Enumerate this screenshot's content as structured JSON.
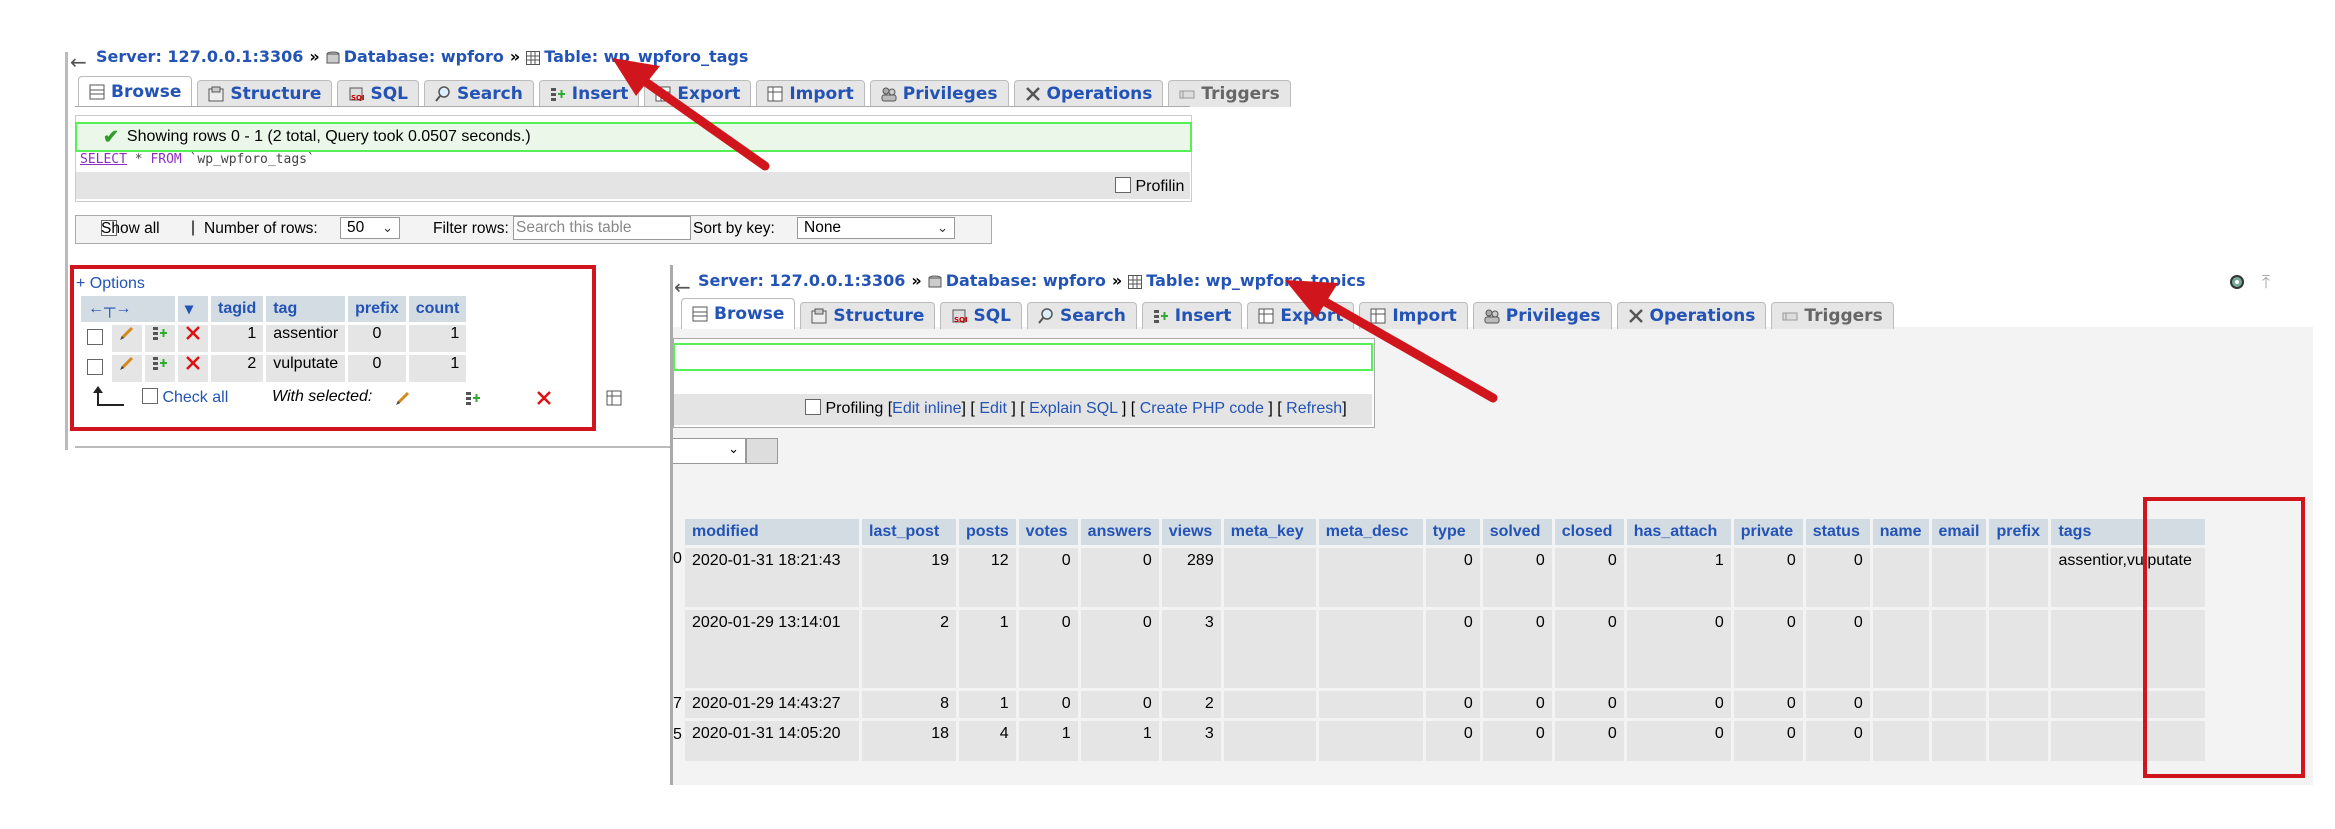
{
  "colors": {
    "link": "#2353b5",
    "header_bg": "#d3dce3",
    "cell_bg": "#e5e5e5",
    "success_border": "#55f055",
    "annotation_red": "#d0161c"
  },
  "top": {
    "breadcrumb": {
      "server": "Server: 127.0.0.1:3306",
      "database": "Database: wpforo",
      "table": "Table: wp_wpforo_tags",
      "sep": "»"
    },
    "tabs": [
      "Browse",
      "Structure",
      "SQL",
      "Search",
      "Insert",
      "Export",
      "Import",
      "Privileges",
      "Operations",
      "Triggers"
    ],
    "success_msg": "Showing rows 0 - 1 (2 total, Query took 0.0507 seconds.)",
    "sql": {
      "select": "SELECT",
      "star": " * ",
      "from": "FROM",
      "table": " `wp_wpforo_tags`"
    },
    "profiling_label": "Profilin",
    "nav": {
      "show_all": "Show all",
      "sep": "|",
      "num_rows_label": "Number of rows:",
      "num_rows_value": "50",
      "filter_label": "Filter rows:",
      "filter_placeholder": "Search this table",
      "sort_label": "Sort by key:",
      "sort_value": "None"
    },
    "options_link": "+ Options",
    "columns": [
      "tagid",
      "tag",
      "prefix",
      "count"
    ],
    "rows": [
      {
        "tagid": "1",
        "tag": "assentior",
        "prefix": "0",
        "count": "1"
      },
      {
        "tagid": "2",
        "tag": "vulputate",
        "prefix": "0",
        "count": "1"
      }
    ],
    "check_all": "Check all",
    "with_selected": "With selected:"
  },
  "bottom": {
    "breadcrumb": {
      "server": "Server: 127.0.0.1:3306",
      "database": "Database: wpforo",
      "table": "Table: wp_wpforo_topics",
      "sep": "»"
    },
    "tabs": [
      "Browse",
      "Structure",
      "SQL",
      "Search",
      "Insert",
      "Export",
      "Import",
      "Privileges",
      "Operations",
      "Triggers"
    ],
    "profiling": {
      "label": "Profiling",
      "edit_inline": "Edit inline",
      "edit": "Edit",
      "explain_sql": "Explain SQL",
      "create_php": "Create PHP code",
      "refresh": "Refresh"
    },
    "columns": [
      "modified",
      "last_post",
      "posts",
      "votes",
      "answers",
      "views",
      "meta_key",
      "meta_desc",
      "type",
      "solved",
      "closed",
      "has_attach",
      "private",
      "status",
      "name",
      "email",
      "prefix",
      "tags"
    ],
    "rows": [
      {
        "modified": "2020-01-31 18:21:43",
        "last_post": "19",
        "posts": "12",
        "votes": "0",
        "answers": "0",
        "views": "289",
        "meta_key": "",
        "meta_desc": "",
        "type": "0",
        "solved": "0",
        "closed": "0",
        "has_attach": "1",
        "private": "0",
        "status": "0",
        "name": "",
        "email": "",
        "prefix": "",
        "tags": "assentior,vulputate"
      },
      {
        "modified": "2020-01-29 13:14:01",
        "last_post": "2",
        "posts": "1",
        "votes": "0",
        "answers": "0",
        "views": "3",
        "meta_key": "",
        "meta_desc": "",
        "type": "0",
        "solved": "0",
        "closed": "0",
        "has_attach": "0",
        "private": "0",
        "status": "0",
        "name": "",
        "email": "",
        "prefix": "",
        "tags": ""
      },
      {
        "modified": "2020-01-29 14:43:27",
        "last_post": "8",
        "posts": "1",
        "votes": "0",
        "answers": "0",
        "views": "2",
        "meta_key": "",
        "meta_desc": "",
        "type": "0",
        "solved": "0",
        "closed": "0",
        "has_attach": "0",
        "private": "0",
        "status": "0",
        "name": "",
        "email": "",
        "prefix": "",
        "tags": ""
      },
      {
        "modified": "2020-01-31 14:05:20",
        "last_post": "18",
        "posts": "4",
        "votes": "1",
        "answers": "1",
        "views": "3",
        "meta_key": "",
        "meta_desc": "",
        "type": "0",
        "solved": "0",
        "closed": "0",
        "has_attach": "0",
        "private": "0",
        "status": "0",
        "name": "",
        "email": "",
        "prefix": "",
        "tags": ""
      }
    ],
    "row_edge_digits": [
      "0",
      "",
      "7",
      "5"
    ]
  }
}
